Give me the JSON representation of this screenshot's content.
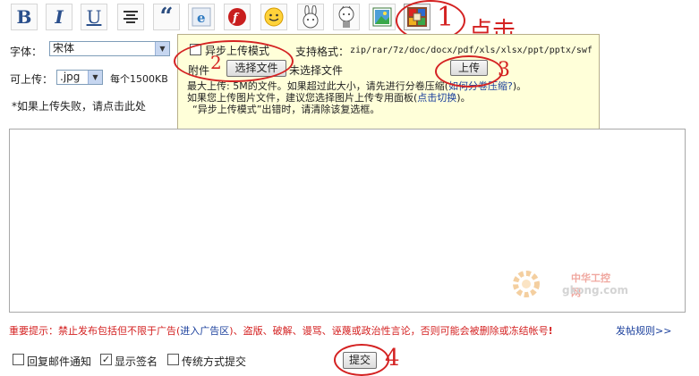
{
  "toolbar": {
    "bold_glyph": "B",
    "italic_glyph": "I",
    "underline_glyph": "U",
    "quote_glyph": "66",
    "icons": [
      "bold-icon",
      "italic-icon",
      "underline-icon",
      "align-icon",
      "quote-icon",
      "ie-icon",
      "flash-icon",
      "smiley-icon",
      "rabbit-icon",
      "character-icon",
      "image-icon",
      "attachment-icon"
    ]
  },
  "annotations": {
    "n1": "1",
    "n2": "2",
    "n3": "3",
    "n4": "4",
    "click": "点击"
  },
  "form": {
    "font_label": "字体：",
    "font_value": "宋体",
    "upload_label": "可上传：",
    "upload_ext": ".jpg",
    "per_size": "每个1500KB",
    "upload_fail_note": "*如果上传失败，请点击此处"
  },
  "popup": {
    "async_label": "异步上传模式",
    "formats_label": "支持格式：",
    "formats_value": "zip/rar/7z/doc/docx/pdf/xls/xlsx/ppt/pptx/swf",
    "attach_label": "附件",
    "choose_button": "选择文件",
    "no_file": "未选择文件",
    "upload_button": "上传",
    "line1_prefix": "最大上传: 5M的文件。如果超过此大小，请先进行分卷压缩(",
    "line1_link": "如何分卷压缩?",
    "line1_suffix": ")。",
    "line2_prefix": "如果您上传图片文件，建议您选择图片上传专用面板(",
    "line2_link": "点击切换",
    "line2_suffix": ")。",
    "line3": "“异步上传模式”出错时，请清除该复选框。"
  },
  "watermark": {
    "name": "中华工控网",
    "domain": "gkong.com"
  },
  "notice": {
    "label": "重要提示：",
    "text_a": "禁止发布包括但不限于广告(",
    "link_ad": "进入广告区",
    "text_b": ")、盗版、破解、谩骂、诬蔑或政治性言论，否则可能会被删除或冻结帐号",
    "bang": "!",
    "rules_link": "发帖规则>>"
  },
  "bottom": {
    "reply_notify": "回复邮件通知",
    "show_signature": "显示签名",
    "classic_submit": "传统方式提交",
    "submit_button": "提交"
  },
  "colors": {
    "accent_red": "#d42222",
    "link_blue": "#1a3f9c",
    "popup_bg": "#ffffd9"
  }
}
